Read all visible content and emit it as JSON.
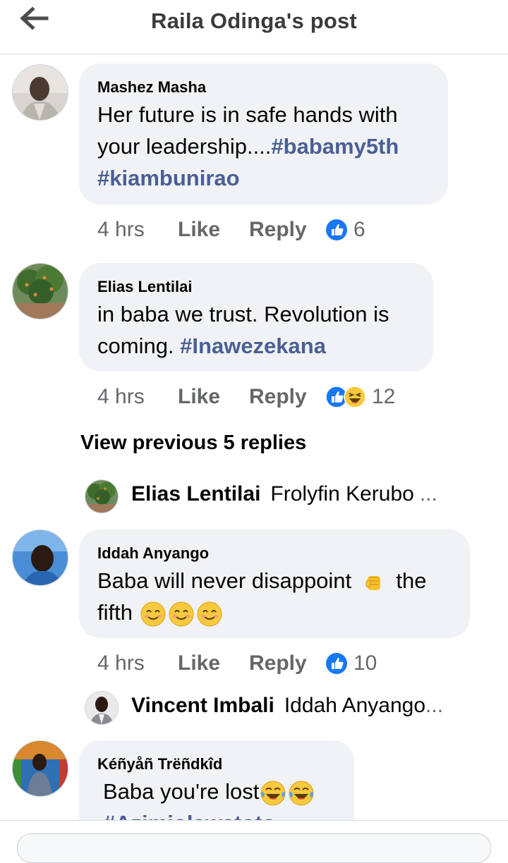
{
  "header": {
    "title": "Raila Odinga's post"
  },
  "comments": [
    {
      "author": "Mashez Masha",
      "text_plain": "Her future is in safe hands with your leadership....",
      "tag1": "#babamy5th",
      "tag2": "#kiambunirao",
      "time": "4 hrs",
      "like": "Like",
      "reply": "Reply",
      "reaction_count": "6",
      "reactions": [
        "like-reaction-icon"
      ]
    },
    {
      "author": "Elias Lentilai",
      "text_plain": "in baba we trust. Revolution is coming. ",
      "tag1": "#Inawezekana",
      "time": "4 hrs",
      "like": "Like",
      "reply": "Reply",
      "reaction_count": "12",
      "reactions": [
        "like-reaction-icon",
        "haha-reaction-icon"
      ]
    },
    {
      "author": "Iddah Anyango",
      "text_part1": "Baba will never disappoint",
      "text_part2": "the",
      "text_part3": "fifth",
      "time": "4 hrs",
      "like": "Like",
      "reply": "Reply",
      "reaction_count": "10",
      "reactions": [
        "like-reaction-icon"
      ]
    },
    {
      "author": "Kéñyåñ Trëñdkîd",
      "text_plain": "Baba you're lost",
      "tag1_partial": "#Azimiolawatoto"
    }
  ],
  "view_previous": "View previous 5 replies",
  "reply_previews": [
    {
      "name": "Elias Lentilai",
      "text": "Frolyfin Kerubo",
      "ellipsis": "..."
    },
    {
      "name": "Vincent Imbali",
      "text": "Iddah Anyango",
      "ellipsis": "..."
    }
  ],
  "colors": {
    "hashtag": "#4a5f94",
    "bubble": "#f0f2f5",
    "meta": "#65676b",
    "like_blue": "#1877f2"
  }
}
